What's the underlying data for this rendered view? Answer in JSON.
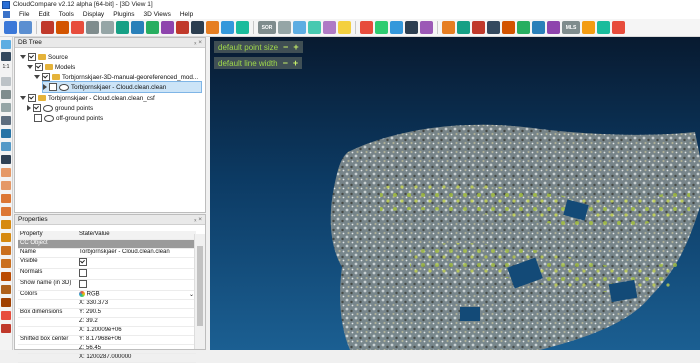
{
  "window": {
    "title": "CloudCompare v2.12 alpha [64-bit] - [3D View 1]"
  },
  "menu": [
    "File",
    "Edit",
    "Tools",
    "Display",
    "Plugins",
    "3D Views",
    "Help"
  ],
  "toolbar": {
    "labels": {
      "sor": "SOR",
      "mls": "MLS"
    }
  },
  "left_toolbar": {
    "label_11": "1:1"
  },
  "db_tree": {
    "header": "DB Tree",
    "header_buttons": "ₓ ×",
    "items": [
      {
        "label": "Source",
        "checked": true
      },
      {
        "label": "Models",
        "checked": true
      },
      {
        "label": "Torbjornskjaer-3D-manual-georeferenced_mod...",
        "checked": true
      },
      {
        "label": "Torbjornskjaer - Cloud.clean.clean",
        "checked": false
      },
      {
        "label": "Torbjornskjaer - Cloud.clean.clean_csf",
        "checked": true
      },
      {
        "label": "ground points",
        "checked": true
      },
      {
        "label": "off-ground points",
        "checked": false
      }
    ]
  },
  "properties": {
    "header": "Properties",
    "columns": [
      "Property",
      "State/Value"
    ],
    "group": "CC Object",
    "rows": [
      {
        "k": "Name",
        "v": "Torbjornskjaer - Cloud.clean.clean"
      },
      {
        "k": "Visible",
        "v": ""
      },
      {
        "k": "Normals",
        "v": ""
      },
      {
        "k": "Show name (in 3D)",
        "v": ""
      },
      {
        "k": "Colors",
        "v": "RGB"
      },
      {
        "k": "",
        "v": "X: 330.373"
      },
      {
        "k": "Box dimensions",
        "v": "Y: 290.5"
      },
      {
        "k": "",
        "v": "Z: 39.2"
      },
      {
        "k": "",
        "v": "X: 1.20009e+06"
      },
      {
        "k": "Shifted box center",
        "v": "Y: 8.17968e+06"
      },
      {
        "k": "",
        "v": "Z: 56.45"
      },
      {
        "k": "",
        "v": "X: 1200287.000000"
      }
    ]
  },
  "view": {
    "overlay_point_size": "default point size",
    "overlay_line_width": "default line width",
    "minus": "−",
    "plus": "+"
  }
}
